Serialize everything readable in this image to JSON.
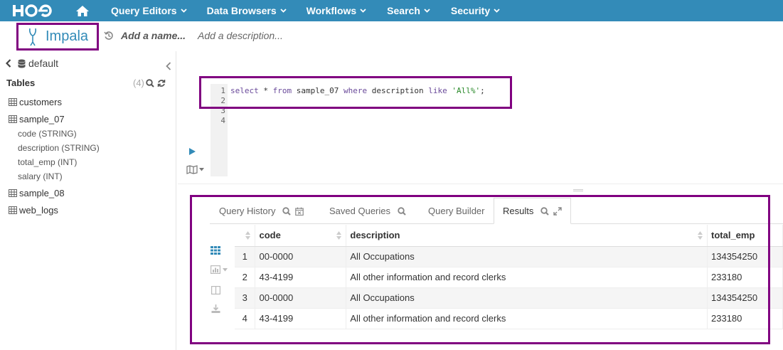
{
  "nav": {
    "logo_text": "HUE",
    "items": [
      {
        "label": "Query Editors"
      },
      {
        "label": "Data Browsers"
      },
      {
        "label": "Workflows"
      },
      {
        "label": "Search"
      },
      {
        "label": "Security"
      }
    ]
  },
  "header": {
    "editor_name": "Impala",
    "name_placeholder": "Add a name...",
    "description_placeholder": "Add a description..."
  },
  "sidebar": {
    "database": "default",
    "tables_title": "Tables",
    "tables_count": "(4)",
    "tables": [
      {
        "name": "customers"
      },
      {
        "name": "sample_07",
        "columns": [
          "code (STRING)",
          "description (STRING)",
          "total_emp (INT)",
          "salary (INT)"
        ]
      },
      {
        "name": "sample_08"
      },
      {
        "name": "web_logs"
      }
    ]
  },
  "editor": {
    "line_numbers": [
      "1",
      "2",
      "3",
      "4"
    ],
    "query_tokens": {
      "select": "select",
      "star": " * ",
      "from": "from",
      "table": " sample_07 ",
      "where": "where",
      "col": " description ",
      "like": "like",
      "space": " ",
      "literal": "'All%'",
      "semi": ";"
    }
  },
  "results": {
    "tabs": [
      {
        "label": "Query History"
      },
      {
        "label": "Saved Queries"
      },
      {
        "label": "Query Builder"
      },
      {
        "label": "Results",
        "active": true
      }
    ],
    "columns": [
      "code",
      "description",
      "total_emp"
    ],
    "rows": [
      {
        "n": "1",
        "code": "00-0000",
        "description": "All Occupations",
        "total_emp": "134354250"
      },
      {
        "n": "2",
        "code": "43-4199",
        "description": "All other information and record clerks",
        "total_emp": "233180"
      },
      {
        "n": "3",
        "code": "00-0000",
        "description": "All Occupations",
        "total_emp": "134354250"
      },
      {
        "n": "4",
        "code": "43-4199",
        "description": "All other information and record clerks",
        "total_emp": "233180"
      }
    ]
  },
  "colors": {
    "nav_bg": "#338bb8",
    "highlight_border": "#800080",
    "accent": "#338bb8"
  }
}
